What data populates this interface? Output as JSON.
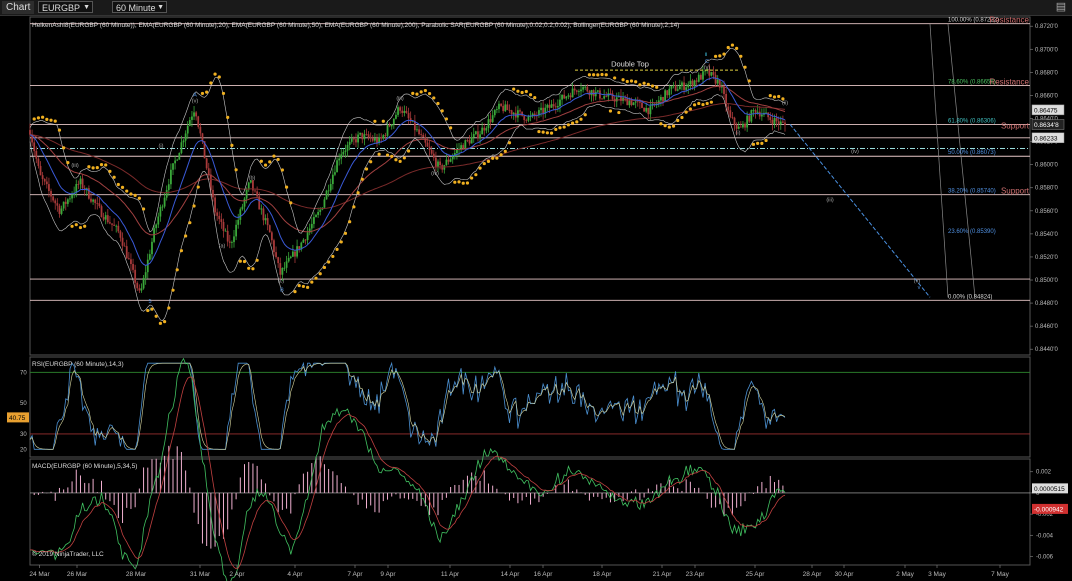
{
  "toolbar": {
    "chart_tab": "Chart",
    "instrument": "EURGBP",
    "interval": "60 Minute"
  },
  "colors": {
    "background": "#000000",
    "fib_line": "#e8c8c8",
    "ema20": "#3a5ad8",
    "ema50": "#a04040",
    "ema200": "#7a2a2a",
    "sar": "#f0b020",
    "bollinger": "#c8c8c8",
    "rsi_line": "#4a8fd0",
    "rsi_avg": "#d8d8a0",
    "rsi_upper": "#2a7a2a",
    "rsi_lower": "#9a3030",
    "macd_hist": "#f0b0d0",
    "macd_line": "#40c060",
    "macd_signal": "#c04040",
    "trend_dashed": "#4a90e0",
    "resistance_label": "#d07070",
    "support_label": "#d07070",
    "fib_green": "#4ac060",
    "fib_cyan": "#40c0c0",
    "fib_blue": "#5090e0"
  },
  "chart_data": [
    {
      "type": "candlestick",
      "title": "HeikenAshi8(EURGBP (60 Minute)), EMA(EURGBP (60 Minute),20), EMA(EURGBP (60 Minute),50), EMA(EURGBP (60 Minute),200), Parabolic SAR(EURGBP (60 Minute),0.02,0.2,0.02), Bollinger(EURGBP (60 Minute),2,14)",
      "ylim": [
        0.8435,
        0.8728
      ],
      "y_ticks": [
        "0.8720'0",
        "0.8700'0",
        "0.8680'0",
        "0.8660'0",
        "0.8640'0",
        "0.8620'0",
        "0.8600'0",
        "0.8580'0",
        "0.8560'0",
        "0.8540'0",
        "0.8520'0",
        "0.8500'0",
        "0.8480'0",
        "0.8460'0",
        "0.8440'0"
      ],
      "y_tick_values": [
        0.872,
        0.87,
        0.868,
        0.866,
        0.864,
        0.862,
        0.86,
        0.858,
        0.856,
        0.854,
        0.852,
        0.85,
        0.848,
        0.846,
        0.844
      ],
      "price_labels": [
        {
          "text": "0.86475",
          "value": 0.86475,
          "style": "light"
        },
        {
          "text": "0.8634'8",
          "value": 0.86348,
          "style": "dark"
        },
        {
          "text": "0.86233",
          "value": 0.86233,
          "style": "light"
        }
      ],
      "horizontal_levels": [
        0.87222,
        0.86686,
        0.86348,
        0.86233,
        0.86073,
        0.8574,
        0.85008,
        0.84824
      ],
      "fib_levels": [
        {
          "label": "100.00% (0.87222)",
          "value": 0.87222,
          "color": "#d8d8d8"
        },
        {
          "label": "78.60% (0.86656)",
          "value": 0.86686,
          "color": "#4ac060"
        },
        {
          "label": "61.80% (0.86306)",
          "value": 0.86348,
          "color": "#40c0c0"
        },
        {
          "label": "50.00% (0.86073)",
          "value": 0.86073,
          "color": "#5090e0"
        },
        {
          "label": "38.20% (0.85740)",
          "value": 0.8574,
          "color": "#5090e0"
        },
        {
          "label": "23.60% (0.85390)",
          "value": 0.8539,
          "color": "#5090e0"
        },
        {
          "label": "0.00% (0.84824)",
          "value": 0.84824,
          "color": "#d8d8d8"
        }
      ],
      "zone_labels": [
        {
          "text": "Resistance",
          "value": 0.87222
        },
        {
          "text": "Resistance",
          "value": 0.86686
        },
        {
          "text": "Support",
          "value": 0.86306
        },
        {
          "text": "Support",
          "value": 0.8574
        }
      ],
      "annotations": [
        {
          "text": "Double Top",
          "x": 0.6,
          "value": 0.8685,
          "color": "#e0e0e0"
        },
        {
          "text": "ii",
          "x": 0.676,
          "value": 0.8694,
          "color": "#40c0e0"
        },
        {
          "text": "C",
          "x": 0.677,
          "value": 0.8688,
          "color": "#5090e0"
        },
        {
          "text": "(v)",
          "x": 0.677,
          "value": 0.8683,
          "color": "#aaa"
        },
        {
          "text": "A",
          "x": 0.165,
          "value": 0.8659,
          "color": "#5090e0"
        },
        {
          "text": "(v)",
          "x": 0.165,
          "value": 0.8654,
          "color": "#aaa"
        },
        {
          "text": "(iii)",
          "x": 0.37,
          "value": 0.8656,
          "color": "#aaa"
        },
        {
          "text": "(i)",
          "x": 0.131,
          "value": 0.8615,
          "color": "#aaa"
        },
        {
          "text": "(iii)",
          "x": 0.045,
          "value": 0.8598,
          "color": "#aaa"
        },
        {
          "text": "(iv)",
          "x": 0.405,
          "value": 0.8591,
          "color": "#aaa"
        },
        {
          "text": "(ii)",
          "x": 0.755,
          "value": 0.8652,
          "color": "#aaa"
        },
        {
          "text": "(i)",
          "x": 0.708,
          "value": 0.8626,
          "color": "#aaa"
        },
        {
          "text": "(iv)",
          "x": 0.825,
          "value": 0.861,
          "color": "#aaa"
        },
        {
          "text": "(iii)",
          "x": 0.8,
          "value": 0.8568,
          "color": "#aaa"
        },
        {
          "text": "(v)",
          "x": 0.887,
          "value": 0.8498,
          "color": "#aaa"
        },
        {
          "text": "v",
          "x": 0.889,
          "value": 0.8492,
          "color": "#5090e0"
        },
        {
          "text": "(a)",
          "x": 0.192,
          "value": 0.8528,
          "color": "#aaa"
        },
        {
          "text": "(b)",
          "x": 0.222,
          "value": 0.8587,
          "color": "#aaa"
        },
        {
          "text": "(c)",
          "x": 0.251,
          "value": 0.8498,
          "color": "#aaa"
        },
        {
          "text": "B",
          "x": 0.252,
          "value": 0.849,
          "color": "#5090e0"
        },
        {
          "text": "5",
          "x": 0.12,
          "value": 0.848,
          "color": "#5090e0"
        },
        {
          "text": "i",
          "x": 0.12,
          "value": 0.8473,
          "color": "#40c0e0"
        }
      ],
      "x_tick_labels": [
        "24 Mar",
        "26 Mar",
        "28 Mar",
        "31 Mar",
        "2 Apr",
        "4 Apr",
        "7 Apr",
        "9 Apr",
        "11 Apr",
        "14 Apr",
        "16 Apr",
        "18 Apr",
        "21 Apr",
        "23 Apr",
        "25 Apr",
        "28 Apr",
        "30 Apr",
        "2 May",
        "3 May",
        "7 May"
      ],
      "x_tick_positions": [
        0.0095,
        0.047,
        0.106,
        0.17,
        0.207,
        0.265,
        0.325,
        0.358,
        0.42,
        0.48,
        0.513,
        0.572,
        0.632,
        0.665,
        0.725,
        0.782,
        0.814,
        0.875,
        0.907,
        0.97
      ],
      "last_bar_x": 0.755,
      "trend_projection": {
        "x_from": 0.76,
        "value_from": 0.8635,
        "x_to": 0.9,
        "value_to": 0.8485
      },
      "double_top_line": {
        "x_from": 0.545,
        "x_to": 0.71,
        "value": 0.8682
      }
    },
    {
      "type": "line",
      "title": "RSI(EURGBP (60 Minute),14,3)",
      "ylim": [
        15,
        80
      ],
      "y_ticks": [
        70,
        50,
        30,
        20
      ],
      "upper_band": 70,
      "lower_band": 30,
      "current_value_label": "40.75",
      "current_value": 40.75
    },
    {
      "type": "bar",
      "title": "MACD(EURGBP (60 Minute),5,34,5)",
      "ylim": [
        -0.0068,
        0.0032
      ],
      "y_ticks": [
        "0.002",
        "0",
        "-0.002",
        "-0.004",
        "-0.006"
      ],
      "y_tick_values": [
        0.002,
        0,
        -0.002,
        -0.004,
        -0.006
      ],
      "value_labels": [
        {
          "text": "0.0000515",
          "value": 5.15e-05,
          "style": "light"
        },
        {
          "text": "-0.000942",
          "value": -0.000942,
          "style": "red"
        }
      ],
      "zero_line": 0
    }
  ],
  "footer": {
    "copyright": "© 2019 NinjaTrader, LLC"
  }
}
